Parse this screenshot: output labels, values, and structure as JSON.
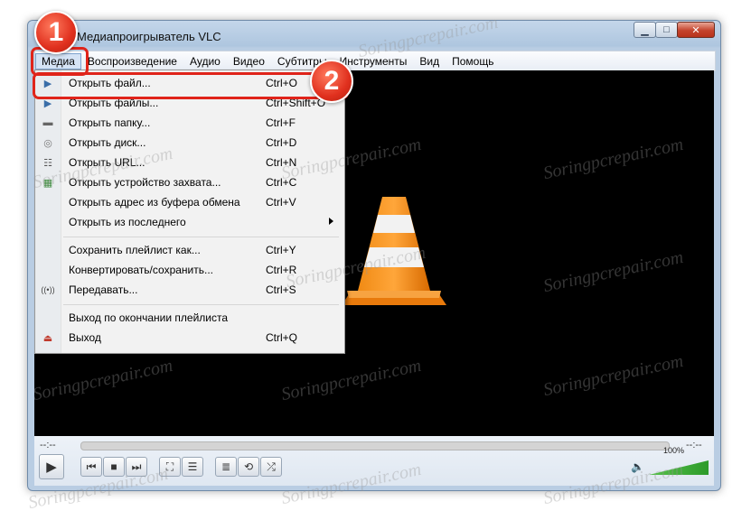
{
  "window": {
    "title": "Медиапроигрыватель VLC"
  },
  "menubar": [
    "Медиа",
    "Воспроизведение",
    "Аудио",
    "Видео",
    "Субтитры",
    "Инструменты",
    "Вид",
    "Помощь"
  ],
  "dropdown": [
    {
      "label": "Открыть файл...",
      "shortcut": "Ctrl+O",
      "icon": "play-file-icon"
    },
    {
      "label": "Открыть файлы...",
      "shortcut": "Ctrl+Shift+O",
      "icon": "play-file-icon"
    },
    {
      "label": "Открыть папку...",
      "shortcut": "Ctrl+F",
      "icon": "folder-icon"
    },
    {
      "label": "Открыть диск...",
      "shortcut": "Ctrl+D",
      "icon": "disc-icon"
    },
    {
      "label": "Открыть URL...",
      "shortcut": "Ctrl+N",
      "icon": "network-icon"
    },
    {
      "label": "Открыть устройство захвата...",
      "shortcut": "Ctrl+C",
      "icon": "capture-card-icon"
    },
    {
      "label": "Открыть адрес из буфера обмена",
      "shortcut": "Ctrl+V",
      "icon": ""
    },
    {
      "label": "Открыть из последнего",
      "shortcut": "",
      "icon": ""
    },
    {
      "label": "Сохранить плейлист как...",
      "shortcut": "Ctrl+Y",
      "icon": ""
    },
    {
      "label": "Конвертировать/сохранить...",
      "shortcut": "Ctrl+R",
      "icon": ""
    },
    {
      "label": "Передавать...",
      "shortcut": "Ctrl+S",
      "icon": "stream-icon"
    },
    {
      "label": "Выход по окончании плейлиста",
      "shortcut": "",
      "icon": ""
    },
    {
      "label": "Выход",
      "shortcut": "Ctrl+Q",
      "icon": "exit-icon"
    }
  ],
  "controls": {
    "elapsed": "--:--",
    "remaining": "--:--",
    "volume": "100%"
  },
  "badges": {
    "one": "1",
    "two": "2"
  },
  "watermark": "Soringpcrepair.com"
}
